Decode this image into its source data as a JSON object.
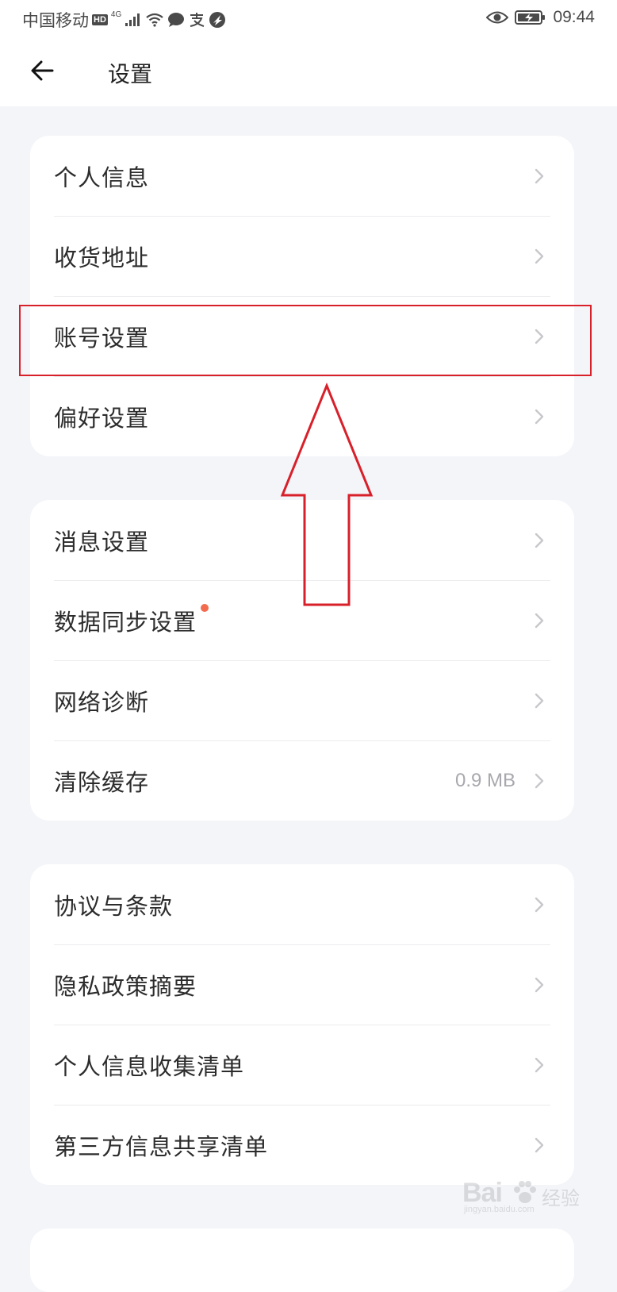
{
  "status_bar": {
    "carrier": "中国移动",
    "hd": "HD",
    "network": "4G",
    "time": "09:44",
    "icons": [
      "signal-icon",
      "wifi-icon",
      "message-icon",
      "alipay-icon",
      "vpn-icon",
      "eye-icon",
      "battery-charging-icon"
    ]
  },
  "header": {
    "title": "设置",
    "back_icon": "back-arrow-icon"
  },
  "groups": [
    {
      "items": [
        {
          "label": "个人信息"
        },
        {
          "label": "收货地址"
        },
        {
          "label": "账号设置",
          "highlighted": true
        },
        {
          "label": "偏好设置"
        }
      ]
    },
    {
      "items": [
        {
          "label": "消息设置"
        },
        {
          "label": "数据同步设置",
          "badge": "red-dot"
        },
        {
          "label": "网络诊断"
        },
        {
          "label": "清除缓存",
          "value": "0.9 MB"
        }
      ]
    },
    {
      "items": [
        {
          "label": "协议与条款"
        },
        {
          "label": "隐私政策摘要"
        },
        {
          "label": "个人信息收集清单"
        },
        {
          "label": "第三方信息共享清单"
        }
      ]
    }
  ],
  "annotation": {
    "color": "#d8202a",
    "arrow_direction": "up"
  },
  "watermark": {
    "brand": "Bai",
    "brand_cn": "经验",
    "url": "jingyan.baidu.com"
  },
  "colors": {
    "page_background": "#f4f5f9",
    "card_background": "#ffffff",
    "badge": "#f26b4f",
    "secondary_text": "#a8a8ae"
  }
}
